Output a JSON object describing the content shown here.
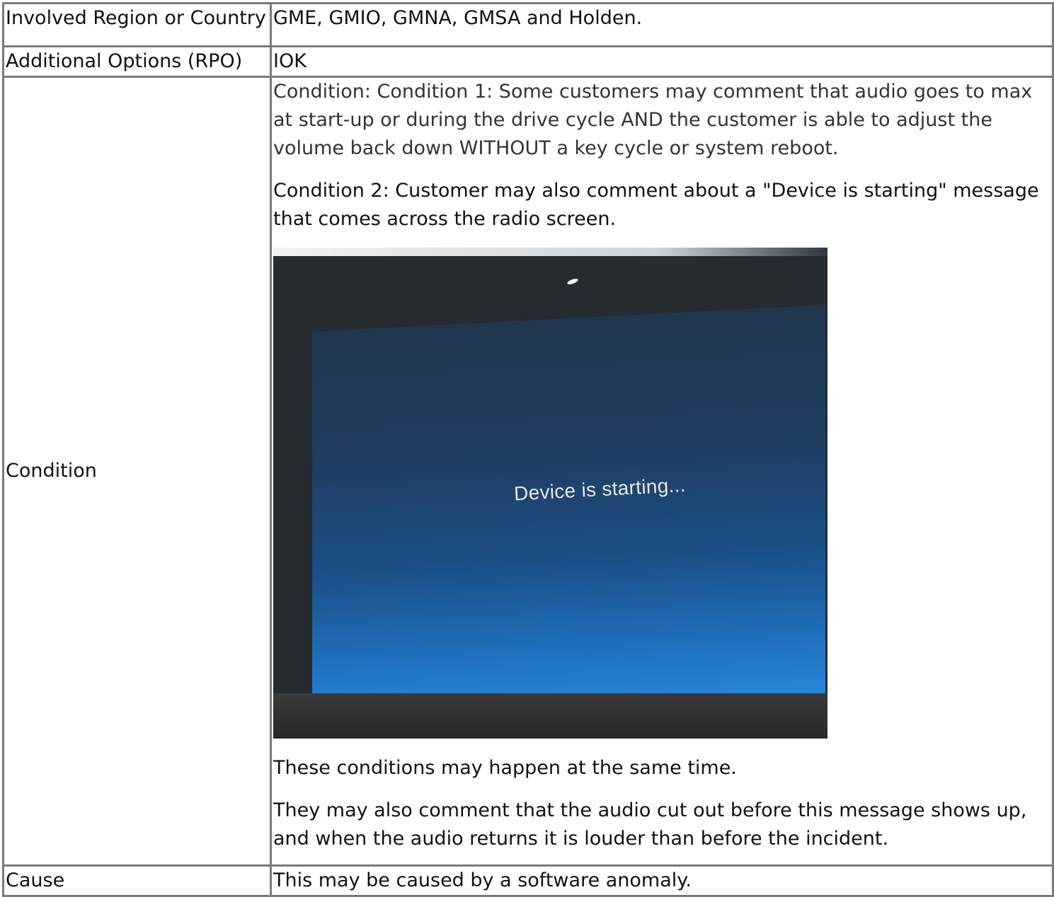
{
  "rows": {
    "region": {
      "label": "Involved Region or Country",
      "value": "GME, GMIO, GMNA, GMSA and Holden."
    },
    "options": {
      "label": "Additional Options (RPO)",
      "value": "IOK"
    },
    "condition": {
      "label": "Condition",
      "para1": "Condition: Condition 1: Some customers may comment that audio goes to max at start-up or during the drive cycle AND the customer is able to adjust the volume back down WITHOUT a key cycle or system reboot.",
      "para2": "Condition 2: Customer may also comment about a \"Device is starting\" message that comes across the radio screen.",
      "screen_message": "Device is starting...",
      "para3": "These conditions may happen at the same time.",
      "para4": "They may also comment that the audio cut out before this message shows up, and when the audio returns it is louder than before the incident."
    },
    "cause": {
      "label": "Cause",
      "value": "This may be caused by a software anomaly."
    }
  }
}
